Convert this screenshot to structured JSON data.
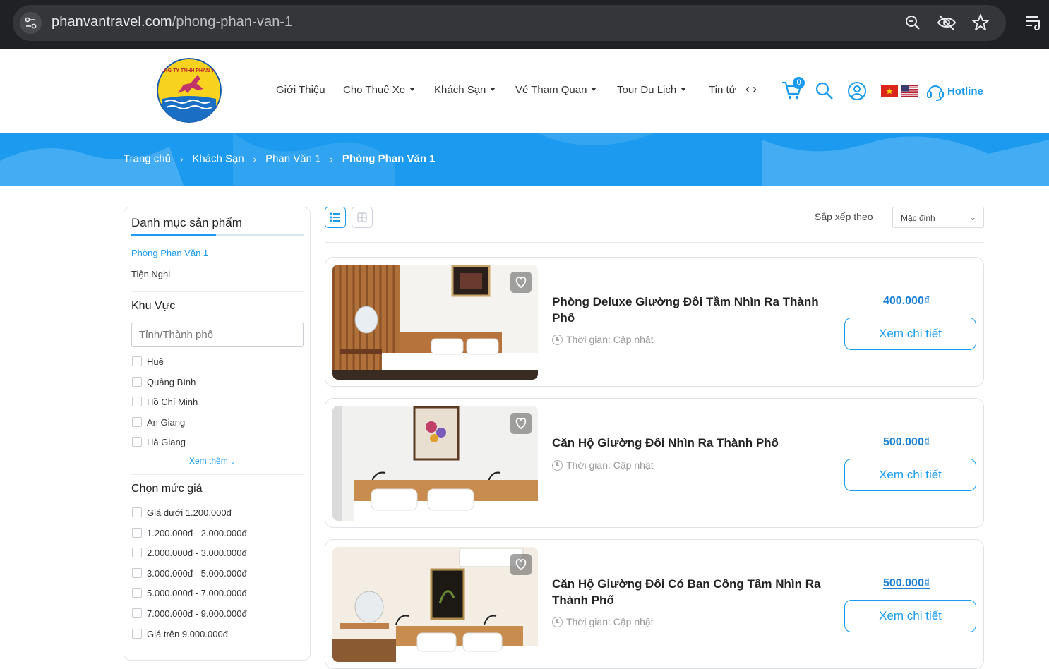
{
  "browser": {
    "url_domain": "phanvantravel.com",
    "url_path": "/phong-phan-van-1"
  },
  "header": {
    "nav": [
      {
        "label": "Giới Thiệu",
        "dropdown": false
      },
      {
        "label": "Cho Thuê Xe",
        "dropdown": true
      },
      {
        "label": "Khách Sạn",
        "dropdown": true
      },
      {
        "label": "Vé Tham Quan",
        "dropdown": true
      },
      {
        "label": "Tour Du Lịch",
        "dropdown": true
      },
      {
        "label": "Tin tứ",
        "dropdown": false
      }
    ],
    "cart_count": "0",
    "hotline": "Hotline",
    "logo_text": "CÔNG TY TNHH PHAN VĂN"
  },
  "breadcrumb": {
    "items": [
      "Trang chủ",
      "Khách Sạn",
      "Phan Văn 1"
    ],
    "current": "Phòng Phan Văn 1"
  },
  "sidebar": {
    "category_title": "Danh mục sản phẩm",
    "categories": [
      {
        "label": "Phòng Phan Văn 1",
        "active": true
      },
      {
        "label": "Tiện Nghi",
        "active": false
      }
    ],
    "region_title": "Khu Vực",
    "region_placeholder": "Tỉnh/Thành phố",
    "regions": [
      "Huế",
      "Quảng Bình",
      "Hồ Chí Minh",
      "An Giang",
      "Hà Giang"
    ],
    "more": "Xem thêm",
    "price_title": "Chọn mức giá",
    "prices": [
      "Giá dưới 1.200.000đ",
      "1.200.000đ - 2.000.000đ",
      "2.000.000đ - 3.000.000đ",
      "3.000.000đ - 5.000.000đ",
      "5.000.000đ - 7.000.000đ",
      "7.000.000đ - 9.000.000đ",
      "Giá trên 9.000.000đ"
    ]
  },
  "toolbar": {
    "sort_label": "Sắp xếp theo",
    "sort_value": "Mặc định"
  },
  "products": [
    {
      "title": "Phòng Deluxe Giường Đôi Tầm Nhìn Ra Thành Phố",
      "time": "Thời gian: Cập nhật",
      "price": "400.000₫",
      "button": "Xem chi tiết"
    },
    {
      "title": "Căn Hộ Giường Đôi Nhìn Ra Thành Phố",
      "time": "Thời gian: Cập nhật",
      "price": "500.000₫",
      "button": "Xem chi tiết"
    },
    {
      "title": "Căn Hộ Giường Đôi Có Ban Công Tầm Nhìn Ra Thành Phố",
      "time": "Thời gian: Cập nhật",
      "price": "500.000₫",
      "button": "Xem chi tiết"
    }
  ],
  "colors": {
    "accent": "#1a9bef",
    "price": "#1a7fd6",
    "band": "#1b9af0",
    "chrome": "#202124"
  }
}
